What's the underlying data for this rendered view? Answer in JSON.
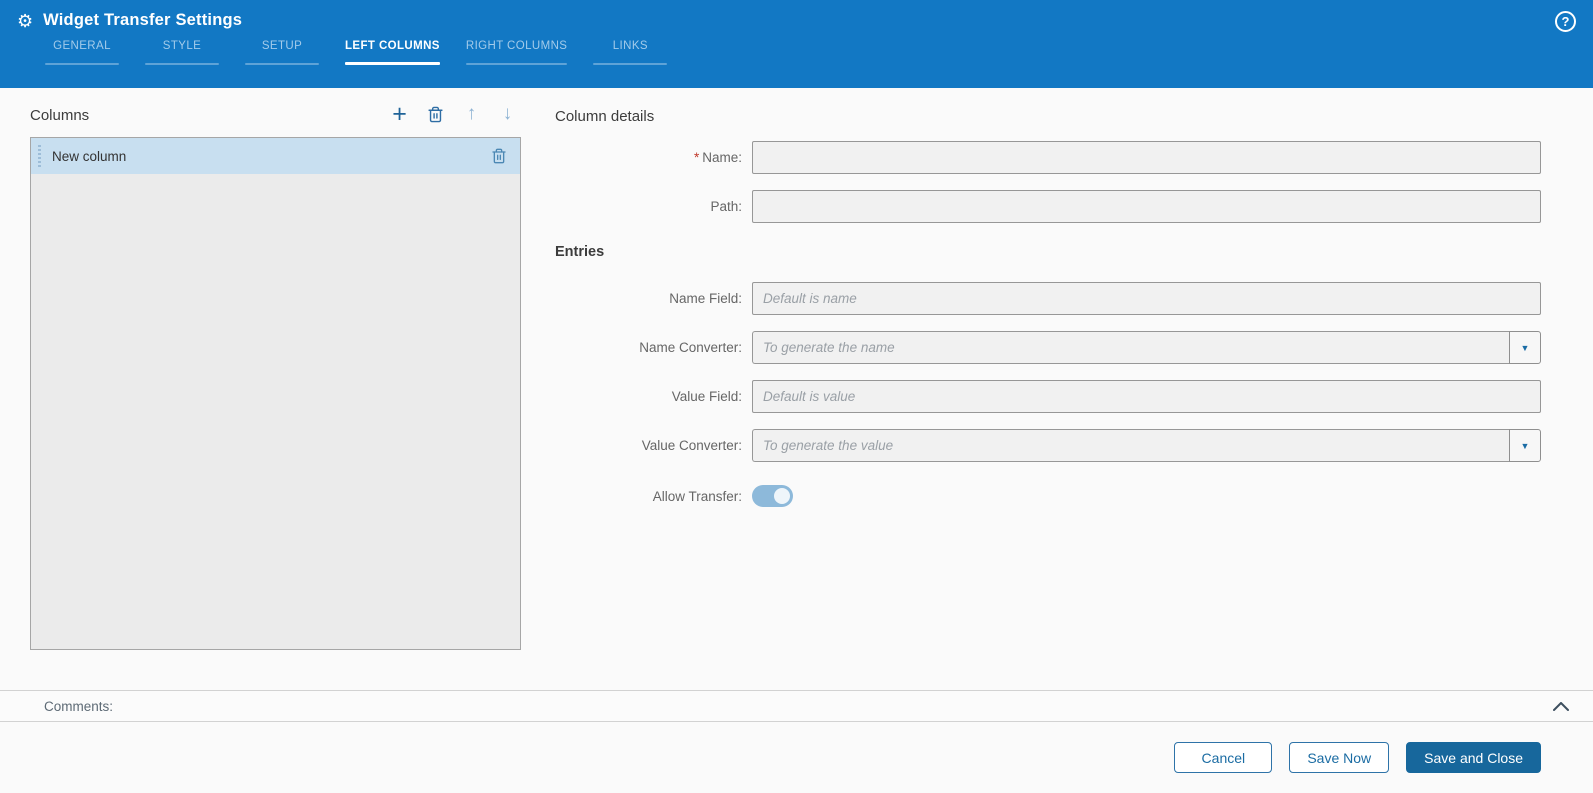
{
  "window": {
    "title": "Widget Transfer Settings"
  },
  "icons": {
    "gear": "⚙",
    "help": "?",
    "add": "+",
    "move_up": "↑",
    "move_down": "↓",
    "caret": "▼"
  },
  "tabs": [
    {
      "label": "GENERAL",
      "active": false
    },
    {
      "label": "STYLE",
      "active": false
    },
    {
      "label": "SETUP",
      "active": false
    },
    {
      "label": "LEFT COLUMNS",
      "active": true
    },
    {
      "label": "RIGHT COLUMNS",
      "active": false
    },
    {
      "label": "LINKS",
      "active": false
    }
  ],
  "columns_panel": {
    "title": "Columns",
    "rows": [
      {
        "label": "New column",
        "selected": true
      }
    ]
  },
  "details": {
    "title": "Column details",
    "name_label": "Name:",
    "name_required_mark": "*",
    "name_value": "",
    "path_label": "Path:",
    "path_value": "",
    "entries_title": "Entries",
    "name_field_label": "Name Field:",
    "name_field_placeholder": "Default is name",
    "name_converter_label": "Name Converter:",
    "name_converter_placeholder": "To generate the name",
    "value_field_label": "Value Field:",
    "value_field_placeholder": "Default is value",
    "value_converter_label": "Value Converter:",
    "value_converter_placeholder": "To generate the value",
    "allow_transfer_label": "Allow Transfer:",
    "allow_transfer_on": true
  },
  "comments": {
    "label": "Comments:"
  },
  "footer": {
    "cancel_label": "Cancel",
    "save_now_label": "Save Now",
    "save_close_label": "Save and Close"
  },
  "colors": {
    "header_blue": "#1278c4",
    "tab_active": "#ffffff",
    "selected_row_blue": "#c8dff0",
    "primary_button_blue": "#17679c",
    "accent_blue": "#1a6ca5",
    "required_red": "#c0392b",
    "list_background": "#ebebeb"
  }
}
